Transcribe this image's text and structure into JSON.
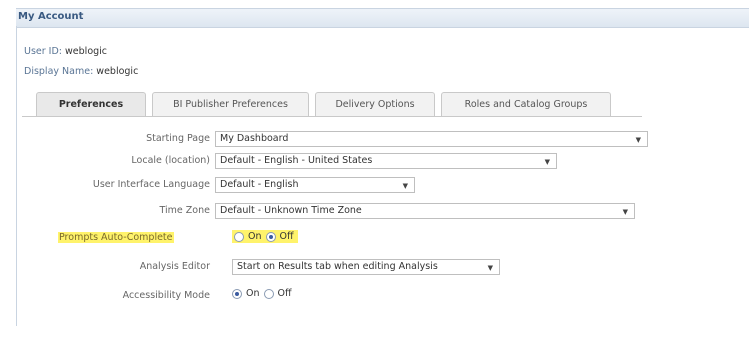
{
  "window": {
    "title": "My Account"
  },
  "user": {
    "id_label": "User ID:",
    "id_value": "weblogic",
    "display_label": "Display Name:",
    "display_value": "weblogic"
  },
  "tabs": [
    {
      "label": "Preferences",
      "active": true
    },
    {
      "label": "BI Publisher Preferences",
      "active": false
    },
    {
      "label": "Delivery Options",
      "active": false
    },
    {
      "label": "Roles and Catalog Groups",
      "active": false
    }
  ],
  "prefs": {
    "starting_page": {
      "label": "Starting Page",
      "value": "My Dashboard"
    },
    "locale": {
      "label": "Locale (location)",
      "value": "Default - English - United States"
    },
    "ui_language": {
      "label": "User Interface Language",
      "value": "Default - English"
    },
    "time_zone": {
      "label": "Time Zone",
      "value": "Default - Unknown Time Zone"
    },
    "prompts": {
      "label": "Prompts Auto-Complete",
      "on_label": "On",
      "off_label": "Off",
      "selected": "Off"
    },
    "analysis_editor": {
      "label": "Analysis Editor",
      "value": "Start on Results tab when editing Analysis"
    },
    "accessibility": {
      "label": "Accessibility Mode",
      "on_label": "On",
      "off_label": "Off",
      "selected": "On"
    }
  },
  "colors": {
    "highlight": "#fff36b",
    "title": "#3a5a82",
    "label": "#5a7595"
  },
  "icons": {
    "dropdown": "chevron-down-icon",
    "radio": "radio-icon"
  }
}
